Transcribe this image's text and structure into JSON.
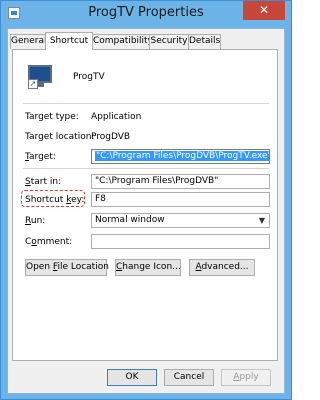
{
  "window": {
    "title": "ProgTV Properties",
    "close_glyph": "✕"
  },
  "tabs": [
    {
      "label": "General"
    },
    {
      "label": "Shortcut",
      "active": true
    },
    {
      "label": "Compatibility"
    },
    {
      "label": "Security"
    },
    {
      "label": "Details"
    }
  ],
  "shortcut": {
    "name": "ProgTV",
    "target_type_label": "Target type:",
    "target_type": "Application",
    "target_location_label": "Target location:",
    "target_location": "ProgDVB",
    "target_label": "Target:",
    "target": "\"C:\\Program Files\\ProgDVB\\ProgTV.exe\"",
    "start_in_label": "Start in:",
    "start_in": "\"C:\\Program Files\\ProgDVB\"",
    "shortcut_key_label": "Shortcut key:",
    "shortcut_key": "F8",
    "run_label": "Run:",
    "run": "Normal window",
    "comment_label": "Comment:",
    "comment": ""
  },
  "buttons": {
    "open_file_location": "Open File Location",
    "change_icon": "Change Icon...",
    "advanced": "Advanced...",
    "ok": "OK",
    "cancel": "Cancel",
    "apply": "Apply"
  },
  "colors": {
    "titlebar": "#6cb4e8",
    "close_button": "#c7483b",
    "selection": "#3399ff",
    "highlight_annotation": "#e03030"
  }
}
